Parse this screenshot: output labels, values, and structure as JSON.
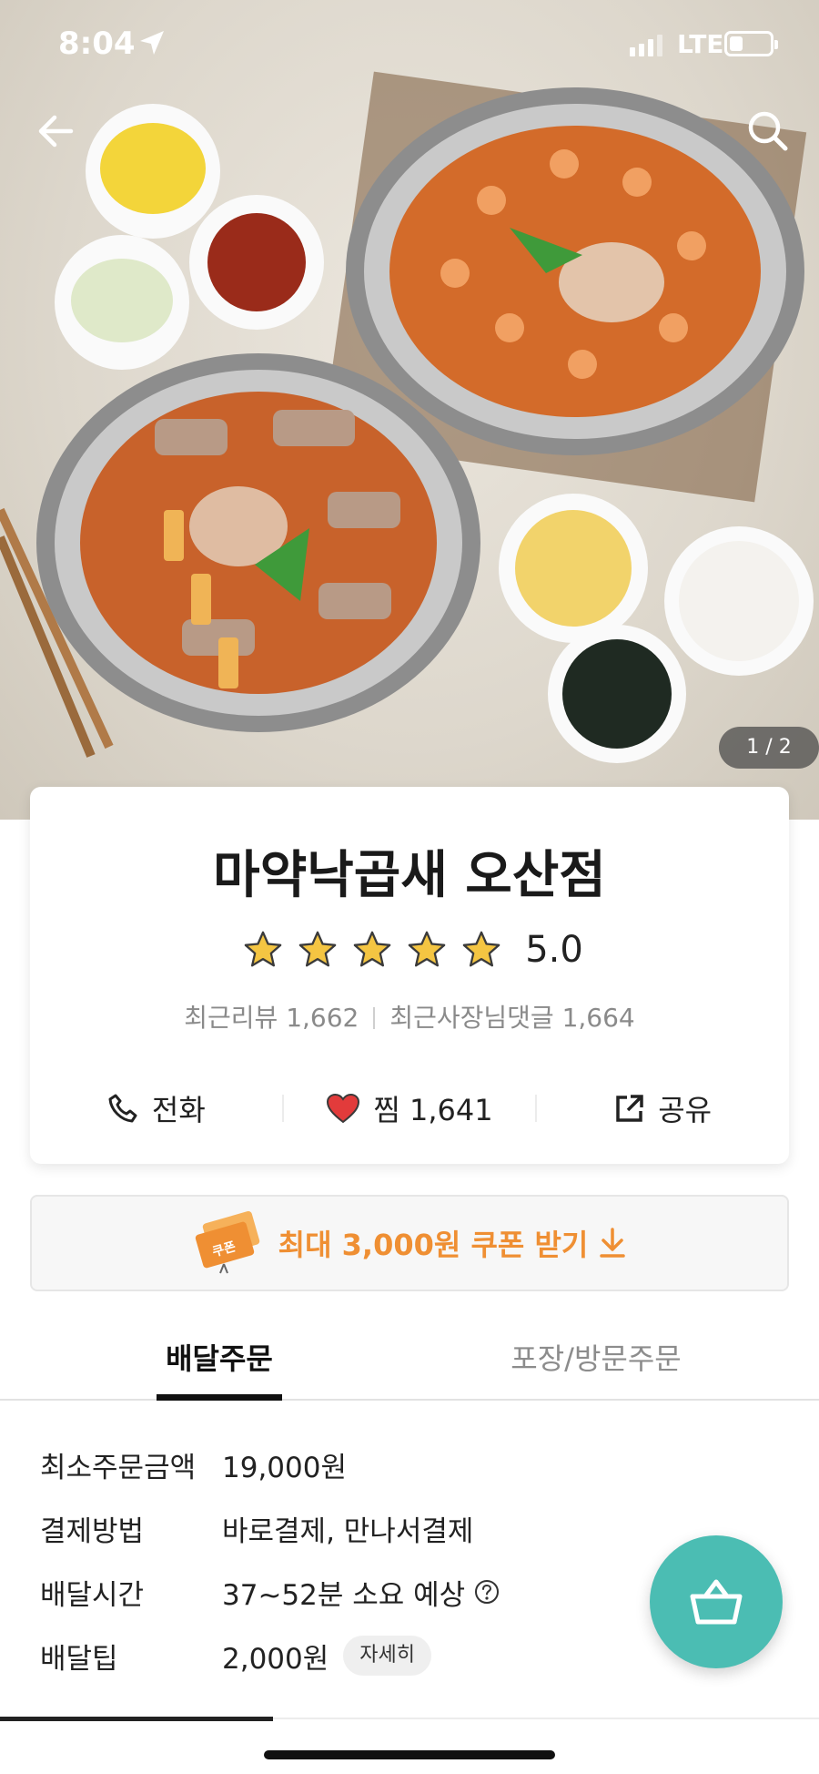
{
  "status_bar": {
    "time": "8:04",
    "network": "LTE"
  },
  "hero": {
    "photo_counter": "1 / 2"
  },
  "store": {
    "name": "마약낙곱새 오산점",
    "rating": "5.0",
    "rating_stars": 5,
    "recent_reviews": "최근리뷰 1,662",
    "owner_replies": "최근사장님댓글 1,664",
    "actions": {
      "call": "전화",
      "like": "찜 1,641",
      "share": "공유"
    }
  },
  "coupon": {
    "badge": "쿠폰",
    "label": "최대 3,000원 쿠폰 받기"
  },
  "tabs": {
    "delivery": "배달주문",
    "pickup": "포장/방문주문"
  },
  "info": {
    "min_order_label": "최소주문금액",
    "min_order_value": "19,000원",
    "payment_label": "결제방법",
    "payment_value": "바로결제, 만나서결제",
    "delivery_time_label": "배달시간",
    "delivery_time_value": "37~52분 소요 예상",
    "delivery_tip_label": "배달팁",
    "delivery_tip_value": "2,000원",
    "detail_button": "자세히"
  },
  "colors": {
    "accent_teal": "#4bbdb3",
    "coupon_orange": "#ef8f33",
    "heart_red": "#e23b3b",
    "star_gold": "#f4c542"
  },
  "icons": [
    "back-arrow-icon",
    "search-icon",
    "star-icon",
    "phone-icon",
    "heart-icon",
    "share-icon",
    "coupon-icon",
    "download-arrow-icon",
    "help-icon",
    "basket-icon"
  ]
}
